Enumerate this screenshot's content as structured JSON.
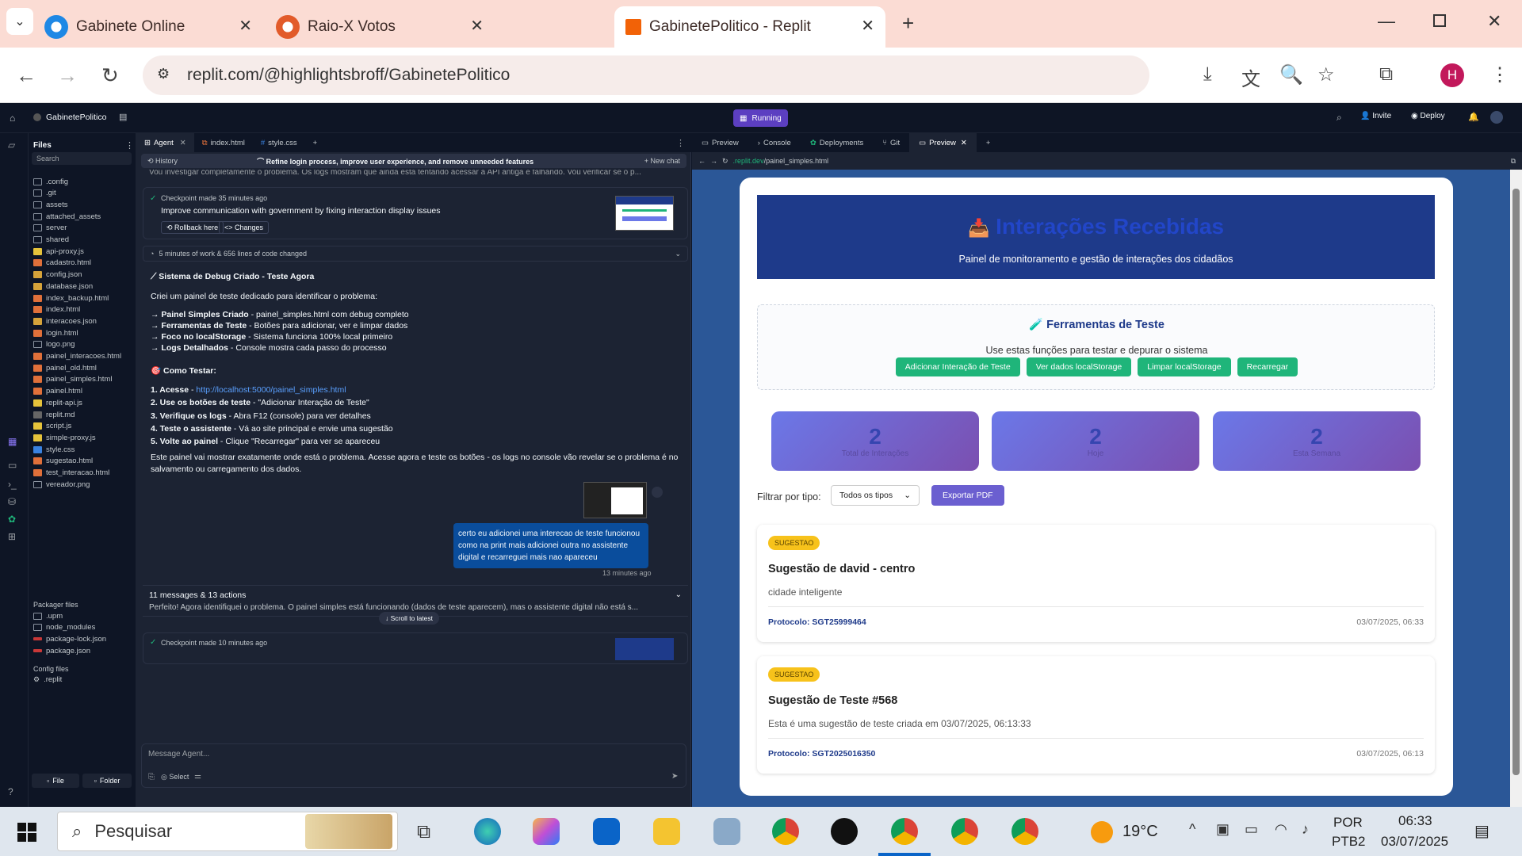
{
  "browser": {
    "tabs": [
      {
        "title": "Gabinete Online"
      },
      {
        "title": "Raio-X Votos"
      },
      {
        "title": "GabinetePolitico - Replit"
      }
    ],
    "url": "replit.com/@highlightsbroff/GabinetePolitico",
    "profile_initial": "H"
  },
  "replit": {
    "project_name": "GabinetePolitico",
    "run_status": "Running",
    "invite_label": "Invite",
    "deploy_label": "Deploy",
    "files_title": "Files",
    "search_placeholder": "Search",
    "files": [
      {
        "name": ".config",
        "type": "folder"
      },
      {
        "name": ".git",
        "type": "folder"
      },
      {
        "name": "assets",
        "type": "folder"
      },
      {
        "name": "attached_assets",
        "type": "folder"
      },
      {
        "name": "server",
        "type": "folder"
      },
      {
        "name": "shared",
        "type": "folder"
      },
      {
        "name": "api-proxy.js",
        "type": "js"
      },
      {
        "name": "cadastro.html",
        "type": "html"
      },
      {
        "name": "config.json",
        "type": "json"
      },
      {
        "name": "database.json",
        "type": "json"
      },
      {
        "name": "index_backup.html",
        "type": "html"
      },
      {
        "name": "index.html",
        "type": "html"
      },
      {
        "name": "interacoes.json",
        "type": "json"
      },
      {
        "name": "login.html",
        "type": "html"
      },
      {
        "name": "logo.png",
        "type": "img"
      },
      {
        "name": "painel_interacoes.html",
        "type": "html"
      },
      {
        "name": "painel_old.html",
        "type": "html"
      },
      {
        "name": "painel_simples.html",
        "type": "html"
      },
      {
        "name": "painel.html",
        "type": "html"
      },
      {
        "name": "replit-api.js",
        "type": "js"
      },
      {
        "name": "replit.md",
        "type": "md"
      },
      {
        "name": "script.js",
        "type": "js"
      },
      {
        "name": "simple-proxy.js",
        "type": "js"
      },
      {
        "name": "style.css",
        "type": "css"
      },
      {
        "name": "sugestao.html",
        "type": "html"
      },
      {
        "name": "test_interacao.html",
        "type": "html"
      },
      {
        "name": "vereador.png",
        "type": "img"
      }
    ],
    "packager_title": "Packager files",
    "packager_files": [
      {
        "name": ".upm",
        "type": "folder"
      },
      {
        "name": "node_modules",
        "type": "folder"
      },
      {
        "name": "package-lock.json",
        "type": "lock"
      },
      {
        "name": "package.json",
        "type": "lock"
      }
    ],
    "config_title": "Config files",
    "config_files": [
      {
        "name": ".replit"
      }
    ],
    "file_btn": "File",
    "folder_btn": "Folder",
    "editor_tabs": [
      {
        "label": "Agent"
      },
      {
        "label": "index.html"
      },
      {
        "label": "style.css"
      }
    ],
    "history_label": "History",
    "chat_title": "Refine login process, improve user experience, and remove unneeded features",
    "new_chat": "New chat",
    "agent": {
      "top_text": "Vou investigar completamente o problema. Os logs mostram que ainda está tentando acessar a API antiga e falhando. Vou verificar se o p...",
      "checkpoint1_time": "Checkpoint made 35 minutes ago",
      "checkpoint1_desc": "Improve communication with government by fixing interaction display issues",
      "rollback": "Rollback here",
      "changes": "Changes",
      "work_summary": "5 minutes of work & 656 lines of code changed",
      "heading1": "Sistema de Debug Criado - Teste Agora",
      "intro": "Criei um painel de teste dedicado para identificar o problema:",
      "bullets": [
        {
          "strong": "→ Painel Simples Criado",
          "rest": " - painel_simples.html com debug completo"
        },
        {
          "strong": "→ Ferramentas de Teste",
          "rest": " - Botões para adicionar, ver e limpar dados"
        },
        {
          "strong": "→ Foco no localStorage",
          "rest": " - Sistema funciona 100% local primeiro"
        },
        {
          "strong": "→ Logs Detalhados",
          "rest": " - Console mostra cada passo do processo"
        }
      ],
      "heading2": "🎯 Como Testar:",
      "steps": [
        {
          "strong": "1. Acesse",
          "rest": " - ",
          "link": "http://localhost:5000/painel_simples.html"
        },
        {
          "strong": "2. Use os botões de teste",
          "rest": " - \"Adicionar Interação de Teste\""
        },
        {
          "strong": "3. Verifique os logs",
          "rest": " - Abra F12 (console) para ver detalhes"
        },
        {
          "strong": "4. Teste o assistente",
          "rest": " - Vá ao site principal e envie uma sugestão"
        },
        {
          "strong": "5. Volte ao painel",
          "rest": " - Clique \"Recarregar\" para ver se apareceu"
        }
      ],
      "closing": "Este painel vai mostrar exatamente onde está o problema. Acesse agora e teste os botões - os logs no console vão revelar se o problema é no salvamento ou carregamento dos dados.",
      "user_msg": "certo eu adicionei uma interecao de teste funcionou como na print mais adicionei outra no assistente digital e recarreguei mais nao apareceu",
      "user_time": "13 minutes ago",
      "messages_summary": "11 messages & 13 actions",
      "messages_preview": "Perfeito! Agora identifiquei o problema. O painel simples está funcionando (dados de teste aparecem), mas o assistente digital não está s...",
      "scroll_latest": "Scroll to latest",
      "checkpoint2_time": "Checkpoint made 10 minutes ago",
      "input_placeholder": "Message Agent...",
      "select_label": "Select"
    },
    "preview_tabs": [
      {
        "label": "Preview"
      },
      {
        "label": "Console"
      },
      {
        "label": "Deployments"
      },
      {
        "label": "Git"
      },
      {
        "label": "Preview"
      }
    ],
    "preview_url_host": ".replit.dev",
    "preview_url_path": "/painel_simples.html"
  },
  "panel": {
    "title": "Interações Recebidas",
    "subtitle": "Painel de monitoramento e gestão de interações dos cidadãos",
    "tools_title": "🧪 Ferramentas de Teste",
    "tools_desc": "Use estas funções para testar e depurar o sistema",
    "tool_buttons": [
      {
        "label": "Adicionar Interação de Teste"
      },
      {
        "label": "Ver dados localStorage"
      },
      {
        "label": "Limpar localStorage"
      },
      {
        "label": "Recarregar"
      }
    ],
    "stats": [
      {
        "value": "2",
        "label": "Total de Interações"
      },
      {
        "value": "2",
        "label": "Hoje"
      },
      {
        "value": "2",
        "label": "Esta Semana"
      }
    ],
    "filter_label": "Filtrar por tipo:",
    "filter_value": "Todos os tipos",
    "export_label": "Exportar PDF",
    "interactions": [
      {
        "badge": "SUGESTAO",
        "title": "Sugestão de david - centro",
        "body": "cidade inteligente",
        "protocol": "Protocolo: SGT25999464",
        "date": "03/07/2025, 06:33"
      },
      {
        "badge": "SUGESTAO",
        "title": "Sugestão de Teste #568",
        "body": "Esta é uma sugestão de teste criada em 03/07/2025, 06:13:33",
        "protocol": "Protocolo: SGT2025016350",
        "date": "03/07/2025, 06:13"
      }
    ]
  },
  "taskbar": {
    "search": "Pesquisar",
    "temp": "19°C",
    "lang1": "POR",
    "lang2": "PTB2",
    "time": "06:33",
    "date": "03/07/2025"
  }
}
